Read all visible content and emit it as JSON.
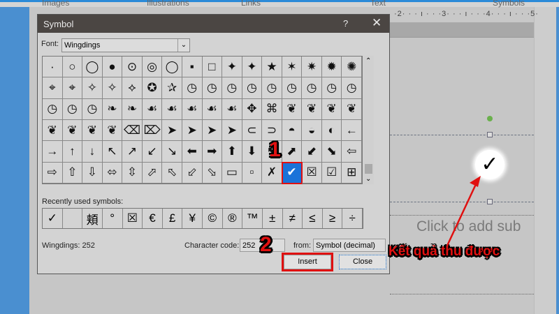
{
  "ribbon": {
    "groups": [
      "Images",
      "Illustrations",
      "Links",
      "Text",
      "Symbols"
    ]
  },
  "ruler": {
    "text": "·2· · · ı · · ·3· · · ı · · ·4· · · ı · · ·5·"
  },
  "slide": {
    "result_symbol": "✓",
    "subtitle_placeholder": "Click to add sub"
  },
  "dialog": {
    "title": "Symbol",
    "help": "?",
    "close_icon": "✕",
    "font_label": "Font:",
    "font_value": "Wingdings",
    "symbols": [
      "·",
      "○",
      "◯",
      "●",
      "⊙",
      "◎",
      "◯",
      "▪",
      "□",
      "✦",
      "✦",
      "★",
      "✶",
      "✷",
      "✹",
      "✺",
      "⌖",
      "⌖",
      "✧",
      "✧",
      "⟡",
      "✪",
      "✰",
      "◷",
      "◷",
      "◷",
      "◷",
      "◷",
      "◷",
      "◷",
      "◷",
      "◷",
      "◷",
      "◷",
      "◷",
      "❧",
      "❧",
      "☙",
      "☙",
      "☙",
      "☙",
      "☙",
      "✥",
      "⌘",
      "❦",
      "❦",
      "❦",
      "❦",
      "❦",
      "❦",
      "❦",
      "❦",
      "⌫",
      "⌦",
      "➤",
      "➤",
      "➤",
      "➤",
      "⊂",
      "⊃",
      "◓",
      "◒",
      "◐",
      "←",
      "→",
      "↑",
      "↓",
      "↖",
      "↗",
      "↙",
      "↘",
      "⬅",
      "➡",
      "⬆",
      "⬇",
      "⬉",
      "⬈",
      "⬋",
      "⬊",
      "⇦",
      "⇨",
      "⇧",
      "⇩",
      "⬄",
      "⇳",
      "⬀",
      "⬁",
      "⬃",
      "⬂",
      "▭",
      "▫",
      "✗",
      "✔",
      "☒",
      "☑",
      "⊞"
    ],
    "selected_index": 92,
    "recent_label": "Recently used symbols:",
    "recent": [
      "✓",
      "",
      "頬",
      "°",
      "☒",
      "€",
      "£",
      "¥",
      "©",
      "®",
      "™",
      "±",
      "≠",
      "≤",
      "≥",
      "÷"
    ],
    "status": "Wingdings: 252",
    "char_code_label": "Character code:",
    "char_code": "252",
    "from_label": "from:",
    "from_value": "Symbol (decimal)",
    "insert": "Insert",
    "close": "Close"
  },
  "annotations": {
    "step1": "1",
    "step2": "2",
    "result_label": "Kết quả thu được"
  }
}
